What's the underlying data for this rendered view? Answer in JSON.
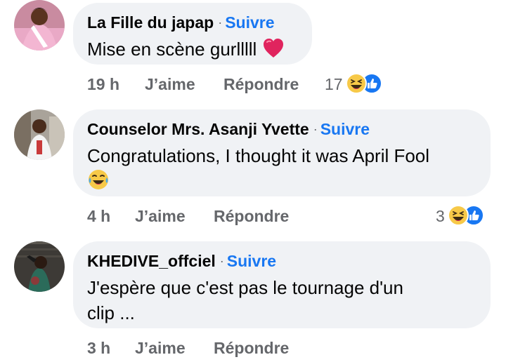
{
  "comments": [
    {
      "author": "La Fille du japap",
      "separator": "·",
      "follow_label": "Suivre",
      "text_lines": [
        "Mise en scène gurlllll"
      ],
      "emoji": "red-heart",
      "time": "19 h",
      "like_label": "J’aime",
      "reply_label": "Répondre",
      "reaction_count": "17",
      "reaction_icons": [
        "laughing-face-icon",
        "like-thumb-icon"
      ]
    },
    {
      "author": "Counselor Mrs. Asanji Yvette",
      "separator": "·",
      "follow_label": "Suivre",
      "text_lines": [
        "Congratulations, I thought it was April Fool"
      ],
      "emoji": "tears-of-joy",
      "time": "4 h",
      "like_label": "J’aime",
      "reply_label": "Répondre",
      "reaction_count": "3",
      "reaction_icons": [
        "laughing-face-icon",
        "like-thumb-icon"
      ]
    },
    {
      "author": "KHEDIVE_offciel",
      "separator": "·",
      "follow_label": "Suivre",
      "text_lines": [
        "J'espère que c'est pas le tournage d'un",
        "clip ..."
      ],
      "time": "3 h",
      "like_label": "J’aime",
      "reply_label": "Répondre"
    }
  ],
  "colors": {
    "bubble_bg": "#f0f2f5",
    "follow_blue": "#1877f2",
    "meta_gray": "#65676b",
    "text": "#050505"
  }
}
